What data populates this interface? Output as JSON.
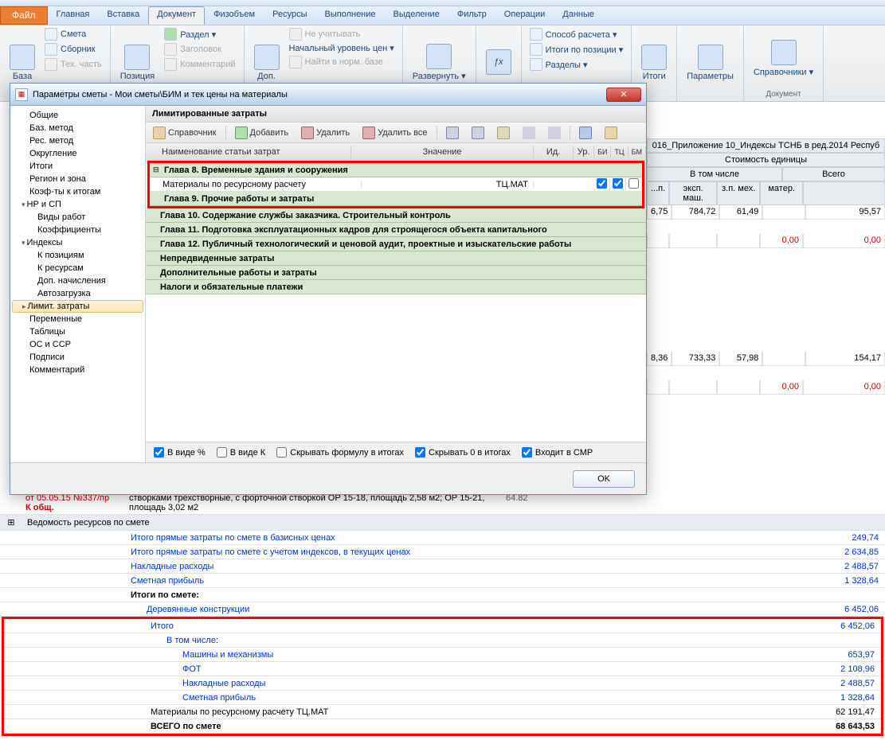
{
  "app_tabs": {
    "file": "Файл",
    "tabs": [
      "Главная",
      "Вставка",
      "Документ",
      "Физобъем",
      "Ресурсы",
      "Выполнение",
      "Выделение",
      "Фильтр",
      "Операции",
      "Данные"
    ],
    "active": 2
  },
  "ribbon": {
    "base": {
      "label": "База",
      "btn": "Смета",
      "btn2": "Сборник",
      "btn3": "Тех. часть"
    },
    "position": {
      "label": "Позиция",
      "btn": "Раздел ▾",
      "btn2": "Заголовок",
      "btn3": "Комментарий"
    },
    "dop": {
      "label": "Доп.",
      "btn1": "Не учитывать",
      "btn2": "Начальный уровень цен ▾",
      "btn3": "Найти в норм. базе"
    },
    "razv": {
      "label": "",
      "btn": "Развернуть ▾"
    },
    "calc": {
      "label": "",
      "btn1": "Способ расчета ▾",
      "btn2": "Итоги по позиции ▾",
      "btn3": "Разделы ▾"
    },
    "itogi": {
      "label": "",
      "btn": "Итоги"
    },
    "params": {
      "label": "",
      "btn": "Параметры"
    },
    "sprav": {
      "label": "Документ",
      "btn": "Справочники ▾"
    }
  },
  "formula_bar": {
    "ref": "016_Приложение 10_Индексы ТСНБ в ред.2014 Респуб"
  },
  "sheet_hdr": {
    "h1": "Стоимость единицы",
    "h2": "В том числе",
    "h3": "Всего",
    "c1": "...п.",
    "c2": "эксп. маш.",
    "c3": "з.п. мех.",
    "c4": "матер."
  },
  "right_vals": {
    "r1": {
      "a": "6,75",
      "b": "784,72",
      "c": "61,49",
      "d": "",
      "e": "95,57"
    },
    "r2": {
      "a": "",
      "b": "",
      "c": "",
      "d": "0,00",
      "e": "0,00"
    },
    "r3": {
      "a": "8,36",
      "b": "733,33",
      "c": "57,98",
      "d": "",
      "e": "154,17"
    },
    "r4": {
      "a": "",
      "b": "",
      "c": "",
      "d": "0,00",
      "e": "0,00"
    }
  },
  "bottom_row": {
    "c1": "от 05.05.15 №337/пр",
    "c1b": "К общ.",
    "c2": "створками трехстворные, с форточной створкой ОР 15-18, площадь 2,58 м2; ОР 15-21, площадь 3,02 м2",
    "c3": "64.82"
  },
  "vedomost": {
    "title": "Ведомость ресурсов по смете"
  },
  "totals": [
    {
      "label": "Итого прямые затраты по смете в базисных ценах",
      "val": "249,74",
      "blue": true
    },
    {
      "label": "Итого прямые затраты по смете с учетом индексов, в текущих ценах",
      "val": "2 634,85",
      "blue": true
    },
    {
      "label": "Накладные расходы",
      "val": "2 488,57",
      "blue": true
    },
    {
      "label": "Сметная прибыль",
      "val": "1 328,64",
      "blue": true
    },
    {
      "label": "Итоги по смете:",
      "val": "",
      "bold": true
    },
    {
      "label": "Деревянные конструкции",
      "val": "6 452,06",
      "blue": true,
      "indent": 1
    }
  ],
  "redbox": [
    {
      "label": "Итого",
      "val": "6 452,06",
      "blue": true,
      "indent": 1
    },
    {
      "label": "В том числе:",
      "val": "",
      "blue": true,
      "indent": 2
    },
    {
      "label": "Машины и механизмы",
      "val": "653,97",
      "blue": true,
      "indent": 3
    },
    {
      "label": "ФОТ",
      "val": "2 108,96",
      "blue": true,
      "indent": 3
    },
    {
      "label": "Накладные расходы",
      "val": "2 488,57",
      "blue": true,
      "indent": 3
    },
    {
      "label": "Сметная прибыль",
      "val": "1 328,64",
      "blue": true,
      "indent": 3
    },
    {
      "label": "Материалы по ресурсному расчету ТЦ.МАТ",
      "val": "62 191,47",
      "indent": 1
    },
    {
      "label": "ВСЕГО по смете",
      "val": "68 643,53",
      "bold": true,
      "indent": 1
    }
  ],
  "dialog": {
    "title": "Параметры сметы - Мои сметы\\БИМ и тек цены на материалы",
    "tree": [
      {
        "t": "Общие"
      },
      {
        "t": "Баз. метод"
      },
      {
        "t": "Рес. метод"
      },
      {
        "t": "Округление"
      },
      {
        "t": "Итоги"
      },
      {
        "t": "Регион и зона"
      },
      {
        "t": "Коэф-ты к итогам"
      },
      {
        "t": "НР и СП",
        "arrow": true,
        "open": true
      },
      {
        "t": "Виды работ",
        "l": 1
      },
      {
        "t": "Коэффициенты",
        "l": 1
      },
      {
        "t": "Индексы",
        "arrow": true,
        "open": true
      },
      {
        "t": "К позициям",
        "l": 1
      },
      {
        "t": "К ресурсам",
        "l": 1
      },
      {
        "t": "Доп. начисления",
        "l": 1
      },
      {
        "t": "Автозагрузка",
        "l": 1
      },
      {
        "t": "Лимит. затраты",
        "arrow": true,
        "active": true
      },
      {
        "t": "Переменные"
      },
      {
        "t": "Таблицы"
      },
      {
        "t": "ОС и ССР"
      },
      {
        "t": "Подписи"
      },
      {
        "t": "Комментарий"
      }
    ],
    "section": "Лимитированные затраты",
    "toolbar": {
      "b1": "Справочник",
      "b2": "Добавить",
      "b3": "Удалить",
      "b4": "Удалить все"
    },
    "cols": {
      "c1": "Наименование статьи затрат",
      "c2": "Значение",
      "c3": "Ид.",
      "c4": "Ур.",
      "c5a": "БИ",
      "c5b": "ТЦ",
      "c5c": "БМ"
    },
    "chapters": {
      "ch8": "Глава 8. Временные здания и сооружения",
      "mat": {
        "name": "Материалы по ресурсному расчету",
        "val": "ТЦ.МАТ",
        "cb1": true,
        "cb2": true,
        "cb3": false
      },
      "ch9": "Глава 9. Прочие работы и затраты",
      "rest": [
        "Глава 10. Содержание службы заказчика. Строительный контроль",
        "Глава 11. Подготовка эксплуатационных кадров для строящегося объекта капитального",
        "Глава 12. Публичный технологический и ценовой аудит, проектные и изыскательские работы",
        "Непредвиденные затраты",
        "Дополнительные работы и затраты",
        "Налоги и обязательные платежи"
      ]
    },
    "opts": {
      "o1": "В виде %",
      "o2": "В виде К",
      "o3": "Скрывать формулу в итогах",
      "o4": "Скрывать 0 в итогах",
      "o5": "Входит в СМР"
    },
    "opts_checked": {
      "o1": true,
      "o2": false,
      "o3": false,
      "o4": true,
      "o5": true
    },
    "ok": "OK"
  }
}
